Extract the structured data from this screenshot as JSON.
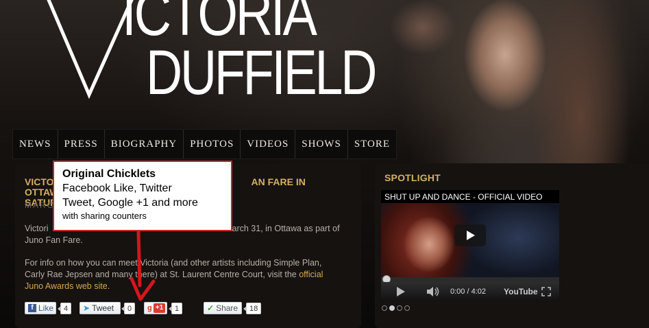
{
  "logo": {
    "line1": "ICTORIA",
    "line2": "DUFFIELD",
    "v_letter": "V"
  },
  "nav": {
    "items": [
      {
        "label": "NEWS"
      },
      {
        "label": "PRESS"
      },
      {
        "label": "BIOGRAPHY"
      },
      {
        "label": "PHOTOS"
      },
      {
        "label": "VIDEOS"
      },
      {
        "label": "SHOWS"
      },
      {
        "label": "STORE"
      }
    ]
  },
  "post": {
    "title_visible_left": "VICTO",
    "title_visible_right": "AN FARE IN OTTAWA ON",
    "title_line2": "SATUR",
    "date": "MARC",
    "p1_start": "Victori",
    "p1_end": "arch 31, in Ottawa as part of",
    "p1_line2": "Juno Fan Fare.",
    "p2_line1": "For info on how you can meet Victoria (and other artists including Simple Plan,",
    "p2_line2_start": "Carly Rae Jepsen and many ",
    "p2_line2_mid": "there) at St. Laurent Centre Court, visit the ",
    "p2_link_part1": "official",
    "p2_link_part2": "Juno Awards web site",
    "p2_end": "."
  },
  "callout": {
    "title": "Original Chicklets",
    "line1": "Facebook Like, Twitter",
    "line2": "Tweet, Google +1 and more",
    "small": "with sharing counters"
  },
  "share": {
    "facebook": {
      "label": "Like",
      "count": "4"
    },
    "twitter": {
      "label": "Tweet",
      "count": "0"
    },
    "google": {
      "label": "+1",
      "count": "1"
    },
    "generic": {
      "label": "Share",
      "count": "18"
    }
  },
  "spotlight": {
    "heading": "SPOTLIGHT",
    "video_title": "SHUT UP AND DANCE - OFFICIAL VIDEO",
    "time": "0:00 / 4:02",
    "youtube_label": "YouTube",
    "slides": 4,
    "active_slide": 2
  },
  "colors": {
    "accent_gold": "#d6b063",
    "callout_border": "#c2272d",
    "arrow": "#d4161c"
  }
}
